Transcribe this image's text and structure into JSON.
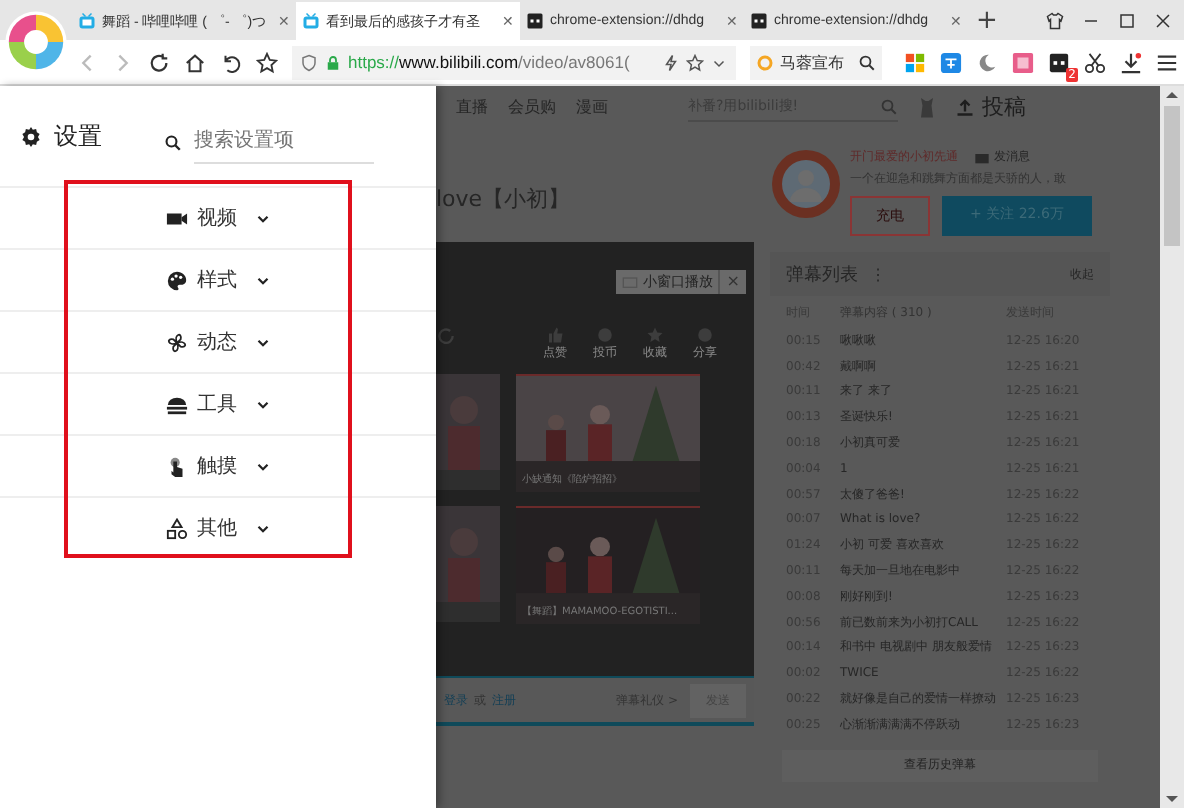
{
  "browser": {
    "tabs": [
      {
        "title": "舞蹈 - 哔哩哔哩 ( ゜- ゜)つ",
        "selected": false,
        "kind": "bili",
        "close": "✕"
      },
      {
        "title": "看到最后的感孩子才有圣",
        "selected": true,
        "kind": "bili",
        "close": "✕"
      },
      {
        "title": "chrome-extension://dhdg",
        "selected": false,
        "kind": "ext",
        "close": "✕"
      },
      {
        "title": "chrome-extension://dhdg",
        "selected": false,
        "kind": "ext",
        "close": "✕"
      }
    ],
    "new_tab": "+",
    "url": {
      "scheme": "https://",
      "host": "www.bilibili.com",
      "path": "/video/av8061("
    },
    "search": {
      "value": "马蓉宣布"
    },
    "badge": "2"
  },
  "settings": {
    "title": "设置",
    "search": {
      "placeholder": "搜索设置项"
    },
    "items": [
      {
        "label": "视频",
        "kind": "video",
        "expanded": false
      },
      {
        "label": "样式",
        "kind": "palette",
        "expanded": false
      },
      {
        "label": "动态",
        "kind": "fan",
        "expanded": false
      },
      {
        "label": "工具",
        "kind": "tools",
        "expanded": false
      },
      {
        "label": "触摸",
        "kind": "touch",
        "expanded": false
      },
      {
        "label": "其他",
        "kind": "shapes",
        "expanded": false
      }
    ]
  },
  "page": {
    "nav": [
      "直播",
      "会员购",
      "漫画"
    ],
    "search": {
      "placeholder": "补番?用bilibili搜!"
    },
    "upload": "投稿",
    "video_title": "love【小初】",
    "uploader": {
      "name": "开门最爱的小初先通",
      "message": "发消息",
      "bio": "一个在迎急和跳舞方面都是天骄的人，敢",
      "charge": "充电",
      "follow": "+ 关注 22.6万"
    },
    "player": {
      "mini": "小窗口播放",
      "close": "×",
      "actions": [
        "点赞",
        "投币",
        "收藏",
        "分享"
      ],
      "videos": [
        {
          "caption": "小缺通知《陷炉招招》"
        },
        {
          "caption": "【舞蹈】MAMAMOO-EGOTISTI..."
        }
      ],
      "login": [
        "登录",
        "或",
        "注册"
      ],
      "etiquette": "弹幕礼仪 >",
      "send": "发送"
    },
    "danmaku": {
      "title": "弹幕列表",
      "menu": "⋮",
      "collapse": "收起",
      "columns": [
        "时间",
        "弹幕内容 ( 310 )",
        "发送时间"
      ],
      "rows": [
        {
          "time": "00:15",
          "text": "啾啾啾",
          "sent": "12-25 16:20"
        },
        {
          "time": "00:42",
          "text": "戴啊啊",
          "sent": "12-25 16:21"
        },
        {
          "time": "00:11",
          "text": "来了 来了",
          "sent": "12-25 16:21"
        },
        {
          "time": "00:13",
          "text": "圣诞快乐!",
          "sent": "12-25 16:21"
        },
        {
          "time": "00:18",
          "text": "小初真可爱",
          "sent": "12-25 16:21"
        },
        {
          "time": "00:04",
          "text": "1",
          "sent": "12-25 16:21"
        },
        {
          "time": "00:57",
          "text": "太傻了爸爸!",
          "sent": "12-25 16:22"
        },
        {
          "time": "00:07",
          "text": "What is love?",
          "sent": "12-25 16:22"
        },
        {
          "time": "01:24",
          "text": "小初 可爱 喜欢喜欢",
          "sent": "12-25 16:22"
        },
        {
          "time": "00:11",
          "text": "每天加一旦地在电影中",
          "sent": "12-25 16:22"
        },
        {
          "time": "00:08",
          "text": "刚好刚到!",
          "sent": "12-25 16:23"
        },
        {
          "time": "00:56",
          "text": "前已数前来为小初打CALL",
          "sent": "12-25 16:22"
        },
        {
          "time": "00:14",
          "text": "和书中 电视剧中 朋友般爱情",
          "sent": "12-25 16:23"
        },
        {
          "time": "00:02",
          "text": "TWICE",
          "sent": "12-25 16:22"
        },
        {
          "time": "00:22",
          "text": "就好像是自己的爱情一样撩动",
          "sent": "12-25 16:23"
        },
        {
          "time": "00:25",
          "text": "心渐渐满满满不停跃动",
          "sent": "12-25 16:23"
        }
      ],
      "history": "查看历史弹幕"
    }
  }
}
